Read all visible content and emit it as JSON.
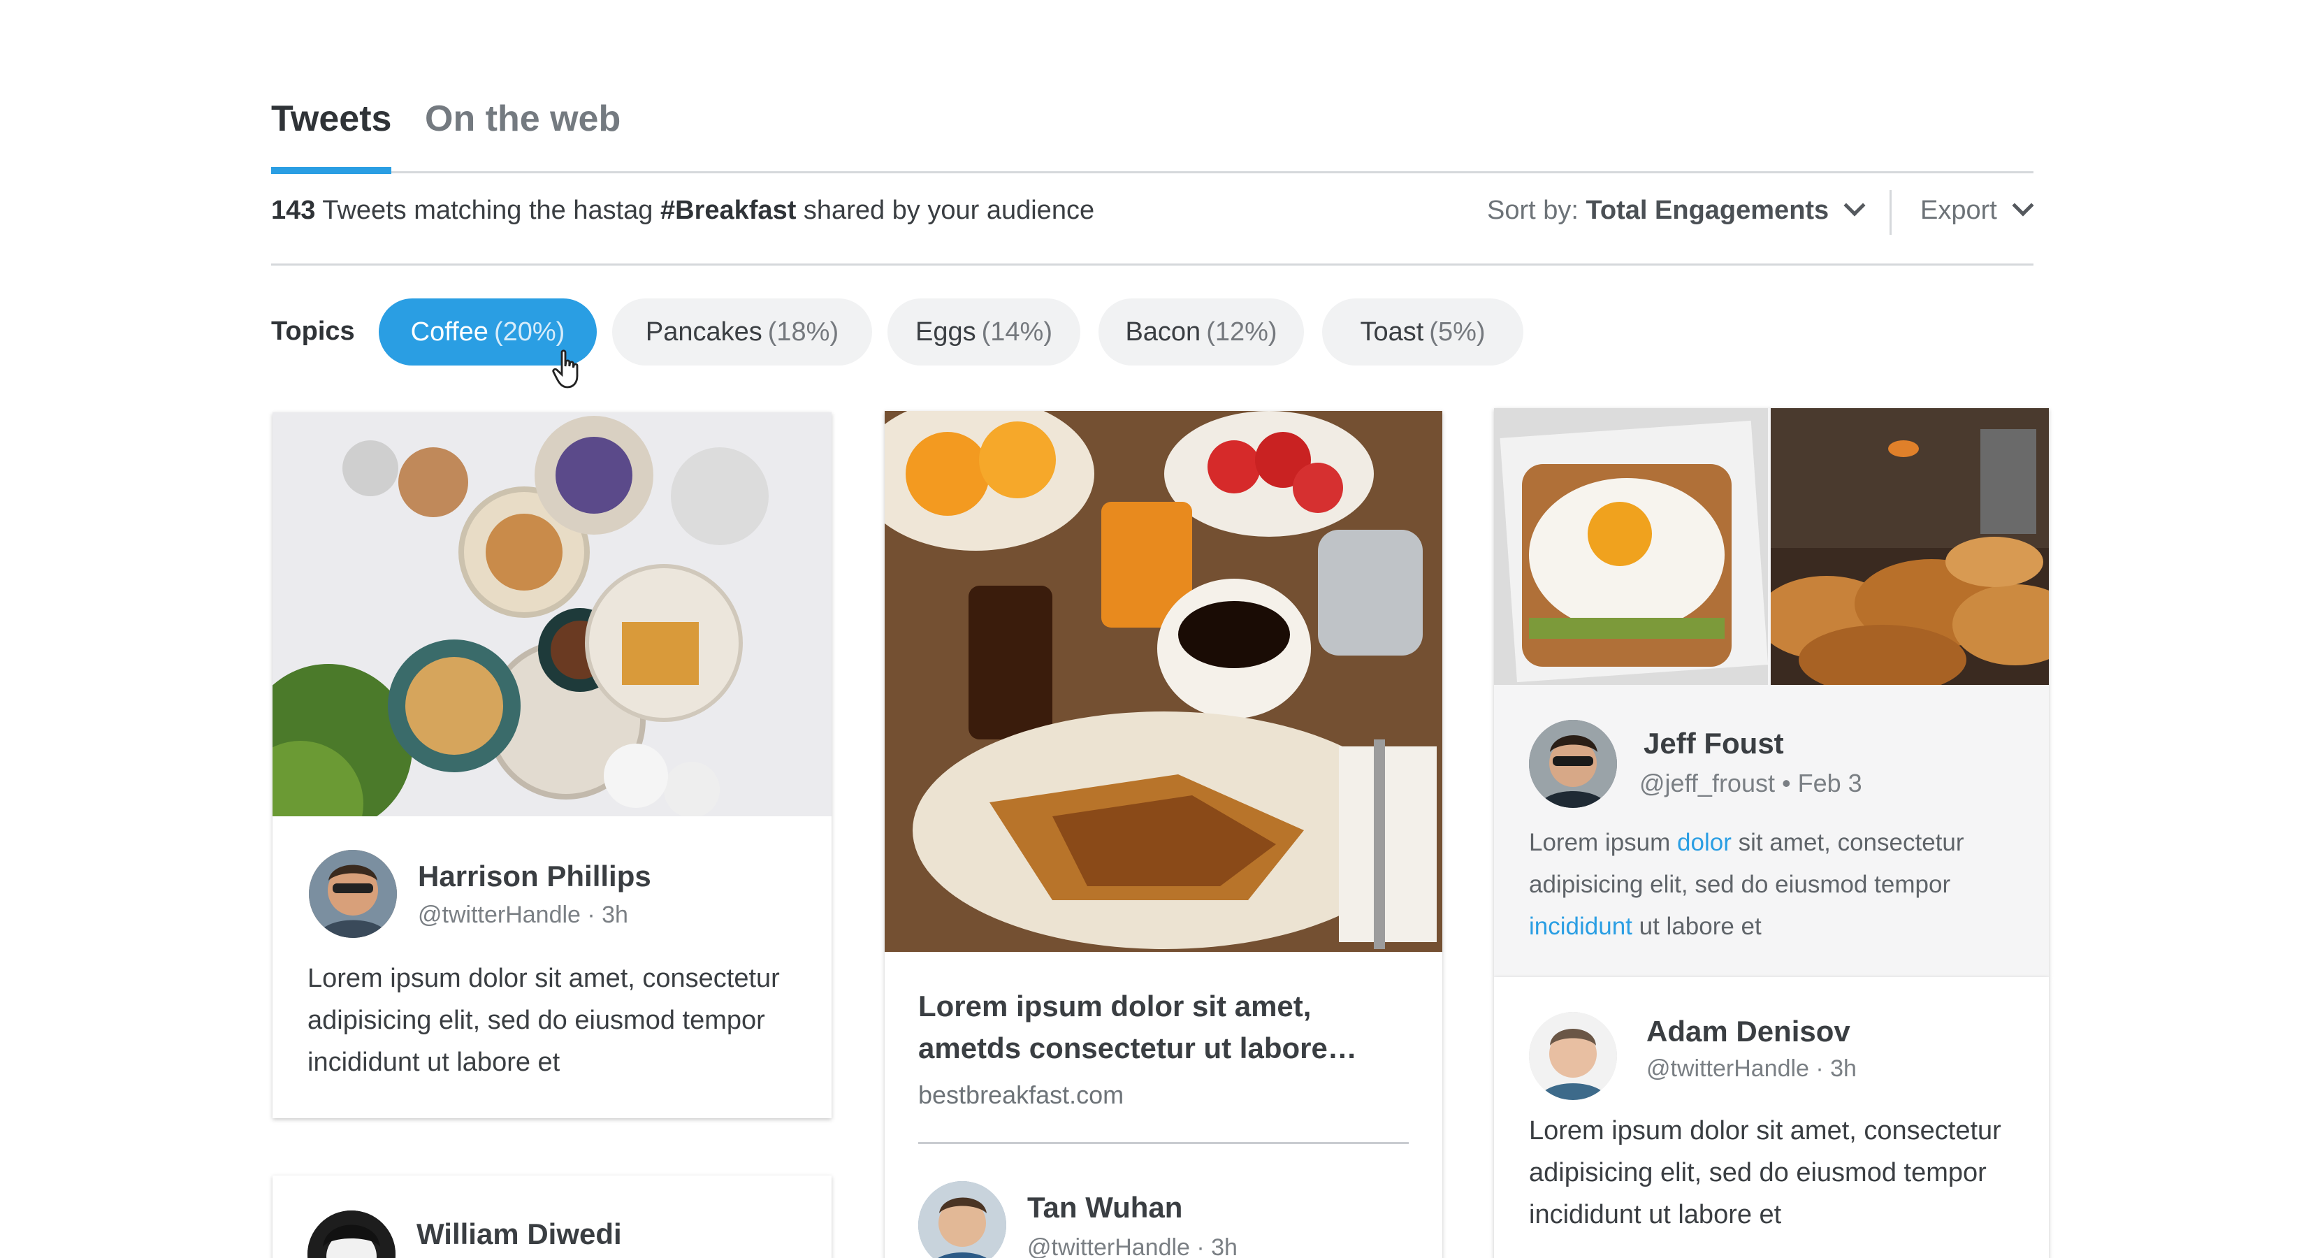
{
  "tabs": [
    {
      "label": "Tweets",
      "active": true
    },
    {
      "label": "On the web",
      "active": false
    }
  ],
  "summary": {
    "count": "143",
    "text_before": "Tweets matching the hastag",
    "hashtag": "#Breakfast",
    "text_after": "shared by your audience"
  },
  "sort": {
    "label": "Sort by:",
    "value": "Total Engagements"
  },
  "export": {
    "label": "Export"
  },
  "topics": {
    "label": "Topics",
    "chips": [
      {
        "name": "Coffee",
        "pct": "(20%)",
        "active": true
      },
      {
        "name": "Pancakes",
        "pct": "(18%)",
        "active": false
      },
      {
        "name": "Eggs",
        "pct": "(14%)",
        "active": false
      },
      {
        "name": "Bacon",
        "pct": "(12%)",
        "active": false
      },
      {
        "name": "Toast",
        "pct": "(5%)",
        "active": false
      }
    ]
  },
  "cards": {
    "harrison": {
      "name": "Harrison Phillips",
      "handle": "@twitterHandle · 3h",
      "text": "Lorem ipsum dolor sit amet, consectetur adipisicing elit, sed do eiusmod tempor incididunt ut labore et"
    },
    "william": {
      "name": "William Diwedi"
    },
    "article": {
      "headline": "Lorem ipsum dolor sit amet, ametds consectetur ut labore…",
      "source": "bestbreakfast.com"
    },
    "tan": {
      "name": "Tan Wuhan",
      "handle": "@twitterHandle · 3h"
    },
    "jeff": {
      "name": "Jeff Foust",
      "handle": "@jeff_froust • Feb 3",
      "text_1": "Lorem ipsum",
      "link_1": "dolor",
      "text_2": "sit amet, consectetur adipisicing elit, sed do eiusmod tempor",
      "link_2": "incididunt",
      "text_3": "ut labore et"
    },
    "adam": {
      "name": "Adam Denisov",
      "handle": "@twitterHandle · 3h",
      "text": "Lorem ipsum dolor sit amet, consectetur adipisicing elit, sed do eiusmod tempor incididunt ut labore et"
    }
  },
  "colors": {
    "accent": "#2a9ee3",
    "text_dark": "#2f3337",
    "chip_bg": "#f1f2f3",
    "divider": "#d5d8db"
  }
}
